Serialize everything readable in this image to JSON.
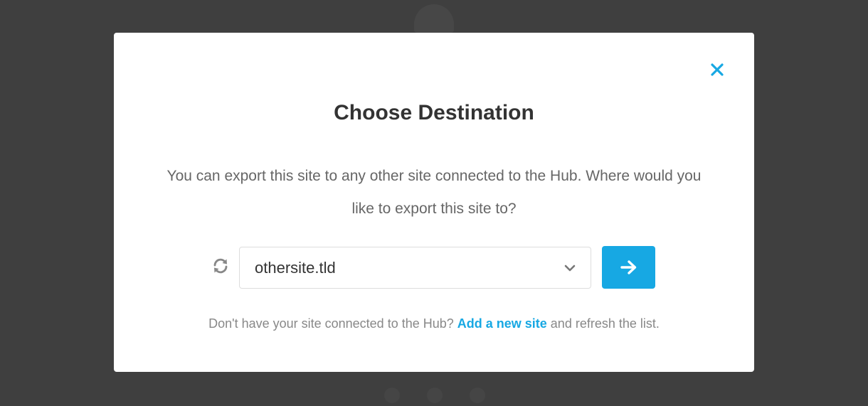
{
  "modal": {
    "title": "Choose Destination",
    "description": "You can export this site to any other site connected to the Hub. Where would you like to export this site to?",
    "destination_select": {
      "selected": "othersite.tld"
    },
    "footer": {
      "prefix": "Don't have your site connected to the Hub? ",
      "link_label": "Add a new site",
      "suffix": " and refresh the list."
    }
  },
  "icons": {
    "close": "close-icon",
    "refresh": "refresh-icon",
    "dropdown": "chevron-down-icon",
    "submit": "arrow-right-icon"
  },
  "colors": {
    "accent": "#17a8e3",
    "backdrop": "#3f3f3f",
    "title": "#333333",
    "body_text": "#666666",
    "muted_text": "#888888"
  }
}
